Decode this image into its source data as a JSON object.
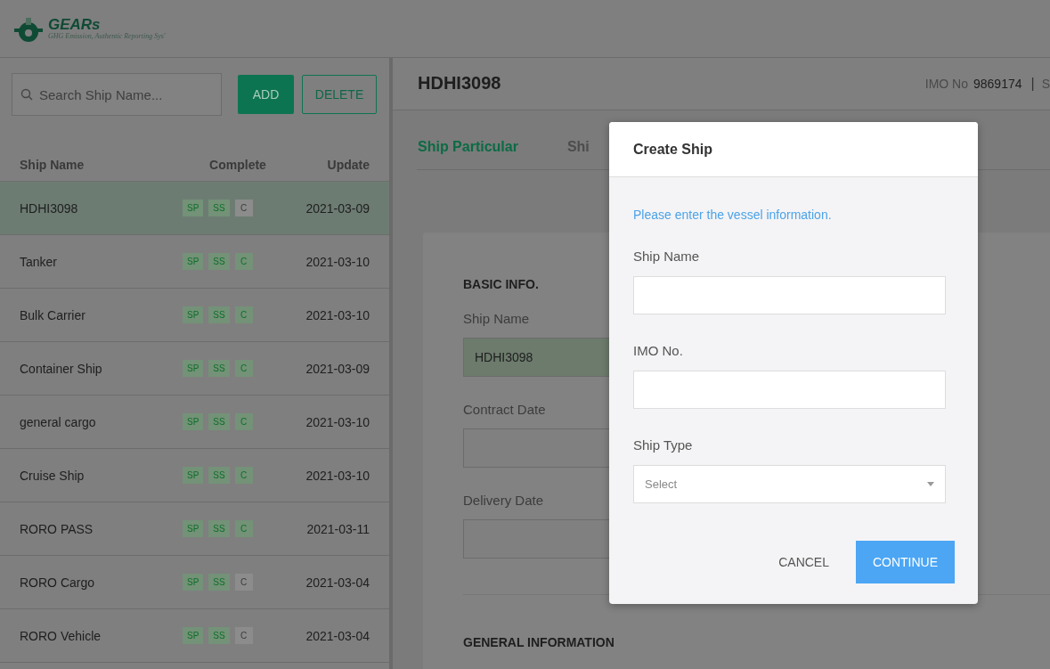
{
  "header": {
    "logo_title": "GEARs",
    "logo_subtitle": "GHG Emission, Authentic Reporting Sys'"
  },
  "sidebar": {
    "search": {
      "placeholder": "Search Ship Name..."
    },
    "buttons": [
      {
        "label": "ADD",
        "kind": "primary"
      },
      {
        "label": "DELETE",
        "kind": "outline"
      }
    ],
    "columns": [
      "Ship Name",
      "Complete",
      "Update"
    ],
    "rows": [
      {
        "name": "HDHI3098",
        "selected": true,
        "badges": [
          {
            "label": "SP",
            "done": true
          },
          {
            "label": "SS",
            "done": true
          },
          {
            "label": "C",
            "done": false
          }
        ],
        "updated": "2021-03-09"
      },
      {
        "name": "Tanker",
        "selected": false,
        "badges": [
          {
            "label": "SP",
            "done": true
          },
          {
            "label": "SS",
            "done": true
          },
          {
            "label": "C",
            "done": true
          }
        ],
        "updated": "2021-03-10"
      },
      {
        "name": "Bulk Carrier",
        "selected": false,
        "badges": [
          {
            "label": "SP",
            "done": true
          },
          {
            "label": "SS",
            "done": true
          },
          {
            "label": "C",
            "done": true
          }
        ],
        "updated": "2021-03-10"
      },
      {
        "name": "Container Ship",
        "selected": false,
        "badges": [
          {
            "label": "SP",
            "done": true
          },
          {
            "label": "SS",
            "done": true
          },
          {
            "label": "C",
            "done": true
          }
        ],
        "updated": "2021-03-09"
      },
      {
        "name": "general cargo",
        "selected": false,
        "badges": [
          {
            "label": "SP",
            "done": true
          },
          {
            "label": "SS",
            "done": true
          },
          {
            "label": "C",
            "done": true
          }
        ],
        "updated": "2021-03-10"
      },
      {
        "name": "Cruise Ship",
        "selected": false,
        "badges": [
          {
            "label": "SP",
            "done": true
          },
          {
            "label": "SS",
            "done": true
          },
          {
            "label": "C",
            "done": true
          }
        ],
        "updated": "2021-03-10"
      },
      {
        "name": "RORO PASS",
        "selected": false,
        "badges": [
          {
            "label": "SP",
            "done": true
          },
          {
            "label": "SS",
            "done": true
          },
          {
            "label": "C",
            "done": true
          }
        ],
        "updated": "2021-03-11"
      },
      {
        "name": "RORO Cargo",
        "selected": false,
        "badges": [
          {
            "label": "SP",
            "done": true
          },
          {
            "label": "SS",
            "done": true
          },
          {
            "label": "C",
            "done": false
          }
        ],
        "updated": "2021-03-04"
      },
      {
        "name": "RORO Vehicle",
        "selected": false,
        "badges": [
          {
            "label": "SP",
            "done": true
          },
          {
            "label": "SS",
            "done": true
          },
          {
            "label": "C",
            "done": false
          }
        ],
        "updated": "2021-03-04"
      }
    ]
  },
  "detail": {
    "title": "HDHI3098",
    "imo_label": "IMO No",
    "imo_value": "9869174",
    "separator": "|",
    "cut_text": "S",
    "tabs": [
      {
        "label": "Ship Particular",
        "selected": true
      },
      {
        "label": "Shi",
        "selected": false
      }
    ],
    "section": "BASIC INFO.",
    "fields": [
      {
        "label": "Ship Name",
        "value": "HDHI3098",
        "filled": true
      },
      {
        "label": "Contract Date",
        "filled": false
      },
      {
        "label": "Delivery Date",
        "filled": false
      }
    ],
    "section_2": "GENERAL INFORMATION"
  },
  "modal": {
    "title": "Create Ship",
    "message": "Please enter the vessel information.",
    "fields": [
      {
        "label": "Ship Name",
        "kind": "text"
      },
      {
        "label": "IMO No.",
        "kind": "text"
      },
      {
        "label": "Ship Type",
        "kind": "select",
        "placeholder": "Select"
      }
    ],
    "buttons": [
      {
        "label": "CANCEL",
        "kind": "text"
      },
      {
        "label": "CONTINUE",
        "kind": "primary"
      }
    ]
  }
}
